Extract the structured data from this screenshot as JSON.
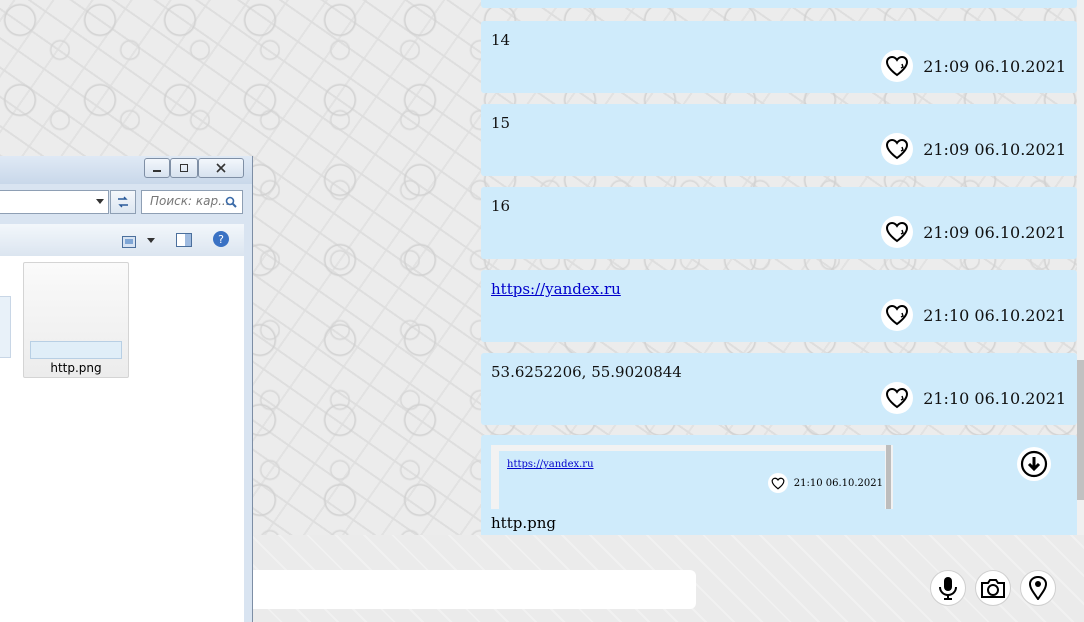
{
  "messages": [
    {
      "text": "14",
      "time": "21:09 06.10.2021"
    },
    {
      "text": "15",
      "time": "21:09 06.10.2021"
    },
    {
      "text": "16",
      "time": "21:09 06.10.2021"
    },
    {
      "text": "https://yandex.ru",
      "time": "21:10 06.10.2021",
      "is_link": true
    },
    {
      "text": "53.6252206, 55.9020844",
      "time": "21:10 06.10.2021"
    }
  ],
  "attachment": {
    "preview_link": "https://yandex.ru",
    "preview_time": "21:10 06.10.2021",
    "filename": "http.png"
  },
  "explorer": {
    "search_placeholder": "Поиск: кар...",
    "file_label": "http.png"
  },
  "icons": {
    "like": "heart-icon",
    "download": "download-icon",
    "mic": "microphone-icon",
    "camera": "camera-icon",
    "location": "location-pin-icon"
  },
  "colors": {
    "bubble": "#cfebfb",
    "link": "#0000cc"
  }
}
